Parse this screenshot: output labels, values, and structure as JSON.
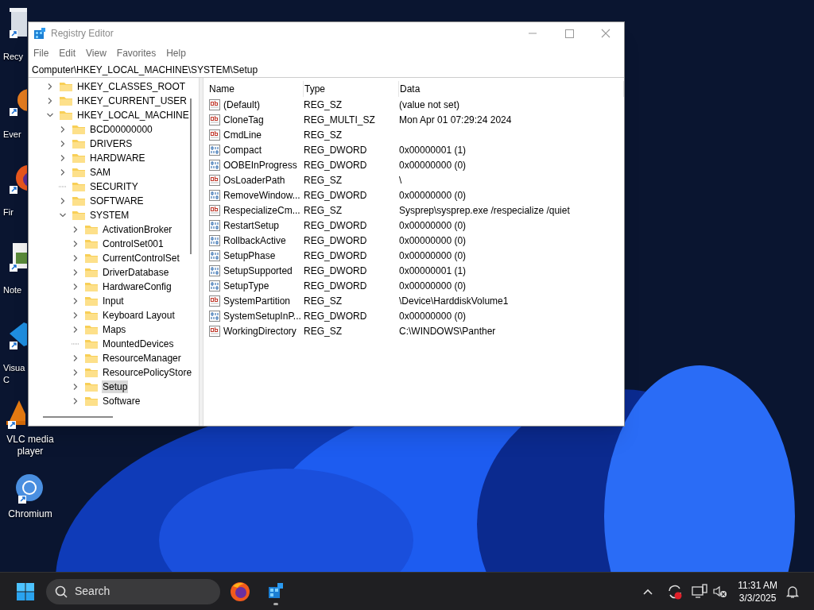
{
  "desktop_icons": [
    {
      "kind": "bin",
      "label": "Recy"
    },
    {
      "kind": "app",
      "label": "Ever"
    },
    {
      "kind": "fox",
      "label": "Fir"
    },
    {
      "kind": "note",
      "label": "Note"
    },
    {
      "kind": "code",
      "label": "Visua\nC"
    },
    {
      "kind": "cone",
      "label": "VLC media\nplayer"
    },
    {
      "kind": "chromium",
      "label": "Chromium"
    }
  ],
  "window": {
    "title": "Registry Editor",
    "menu": [
      "File",
      "Edit",
      "View",
      "Favorites",
      "Help"
    ],
    "address": "Computer\\HKEY_LOCAL_MACHINE\\SYSTEM\\Setup",
    "tree": [
      {
        "label": "HKEY_CLASSES_ROOT",
        "expandable": true,
        "expanded": false,
        "selected": false
      },
      {
        "label": "HKEY_CURRENT_USER",
        "expandable": true,
        "expanded": false,
        "selected": false
      },
      {
        "label": "HKEY_LOCAL_MACHINE",
        "expandable": true,
        "expanded": true,
        "selected": false,
        "children": [
          {
            "label": "BCD00000000",
            "expandable": true,
            "expanded": false,
            "selected": false
          },
          {
            "label": "DRIVERS",
            "expandable": true,
            "expanded": false,
            "selected": false
          },
          {
            "label": "HARDWARE",
            "expandable": true,
            "expanded": false,
            "selected": false
          },
          {
            "label": "SAM",
            "expandable": true,
            "expanded": false,
            "selected": false
          },
          {
            "label": "SECURITY",
            "expandable": false,
            "expanded": false,
            "selected": false
          },
          {
            "label": "SOFTWARE",
            "expandable": true,
            "expanded": false,
            "selected": false
          },
          {
            "label": "SYSTEM",
            "expandable": true,
            "expanded": true,
            "selected": false,
            "children": [
              {
                "label": "ActivationBroker",
                "expandable": true,
                "expanded": false,
                "selected": false
              },
              {
                "label": "ControlSet001",
                "expandable": true,
                "expanded": false,
                "selected": false
              },
              {
                "label": "CurrentControlSet",
                "expandable": true,
                "expanded": false,
                "selected": false
              },
              {
                "label": "DriverDatabase",
                "expandable": true,
                "expanded": false,
                "selected": false
              },
              {
                "label": "HardwareConfig",
                "expandable": true,
                "expanded": false,
                "selected": false
              },
              {
                "label": "Input",
                "expandable": true,
                "expanded": false,
                "selected": false
              },
              {
                "label": "Keyboard Layout",
                "expandable": true,
                "expanded": false,
                "selected": false
              },
              {
                "label": "Maps",
                "expandable": true,
                "expanded": false,
                "selected": false
              },
              {
                "label": "MountedDevices",
                "expandable": false,
                "expanded": false,
                "selected": false
              },
              {
                "label": "ResourceManager",
                "expandable": true,
                "expanded": false,
                "selected": false
              },
              {
                "label": "ResourcePolicyStore",
                "expandable": true,
                "expanded": false,
                "selected": false
              },
              {
                "label": "Setup",
                "expandable": true,
                "expanded": false,
                "selected": true
              },
              {
                "label": "Software",
                "expandable": true,
                "expanded": false,
                "selected": false
              }
            ]
          }
        ]
      }
    ],
    "columns": [
      "Name",
      "Type",
      "Data"
    ],
    "values": [
      {
        "kind": "string",
        "name": "(Default)",
        "type": "REG_SZ",
        "data": "(value not set)"
      },
      {
        "kind": "string",
        "name": "CloneTag",
        "type": "REG_MULTI_SZ",
        "data": "Mon Apr 01 07:29:24 2024"
      },
      {
        "kind": "string",
        "name": "CmdLine",
        "type": "REG_SZ"
      },
      {
        "kind": "binary",
        "name": "Compact",
        "type": "REG_DWORD",
        "data": "0x00000001 (1)"
      },
      {
        "kind": "binary",
        "name": "OOBEInProgress",
        "type": "REG_DWORD",
        "data": "0x00000000 (0)"
      },
      {
        "kind": "string",
        "name": "OsLoaderPath",
        "type": "REG_SZ",
        "data": "\\"
      },
      {
        "kind": "binary",
        "name": "RemoveWindow...",
        "type": "REG_DWORD",
        "data": "0x00000000 (0)"
      },
      {
        "kind": "string",
        "name": "RespecializeCm...",
        "type": "REG_SZ",
        "data": "Sysprep\\sysprep.exe /respecialize /quiet"
      },
      {
        "kind": "binary",
        "name": "RestartSetup",
        "type": "REG_DWORD",
        "data": "0x00000000 (0)"
      },
      {
        "kind": "binary",
        "name": "RollbackActive",
        "type": "REG_DWORD",
        "data": "0x00000000 (0)"
      },
      {
        "kind": "binary",
        "name": "SetupPhase",
        "type": "REG_DWORD",
        "data": "0x00000000 (0)"
      },
      {
        "kind": "binary",
        "name": "SetupSupported",
        "type": "REG_DWORD",
        "data": "0x00000001 (1)"
      },
      {
        "kind": "binary",
        "name": "SetupType",
        "type": "REG_DWORD",
        "data": "0x00000000 (0)"
      },
      {
        "kind": "string",
        "name": "SystemPartition",
        "type": "REG_SZ",
        "data": "\\Device\\HarddiskVolume1"
      },
      {
        "kind": "binary",
        "name": "SystemSetupInP...",
        "type": "REG_DWORD",
        "data": "0x00000000 (0)"
      },
      {
        "kind": "string",
        "name": "WorkingDirectory",
        "type": "REG_SZ",
        "data": "C:\\WINDOWS\\Panther"
      }
    ]
  },
  "taskbar": {
    "search_placeholder": "Search",
    "time": "11:31 AM",
    "date": "3/3/2025"
  }
}
